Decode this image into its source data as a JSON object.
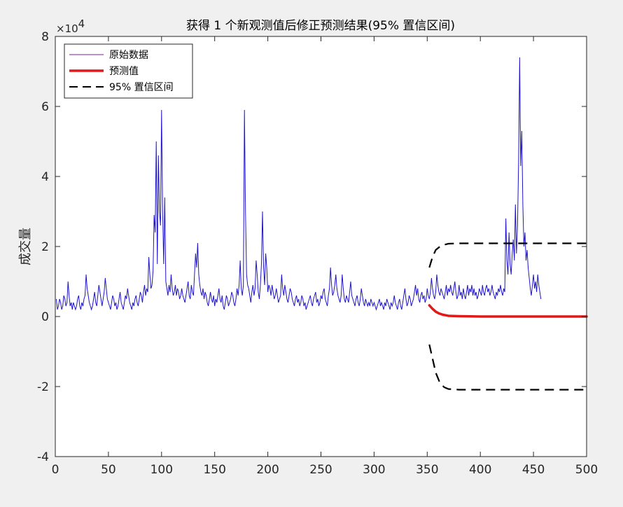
{
  "chart_data": {
    "type": "line",
    "title": "获得 1 个新观测值后修正预测结果(95% 置信区间)",
    "xlabel": "",
    "ylabel": "成交量",
    "y_exponent_label": "×10",
    "y_exponent_power": "4",
    "xlim": [
      0,
      500
    ],
    "ylim": [
      -4,
      8
    ],
    "y_scale_factor": 10000,
    "xticks": [
      "0",
      "50",
      "100",
      "150",
      "200",
      "250",
      "300",
      "350",
      "400",
      "450",
      "500"
    ],
    "yticks": [
      "8",
      "6",
      "4",
      "2",
      "0",
      "-2",
      "-4"
    ],
    "grid": false,
    "legend_position": "top-left",
    "legend": [
      "原始数据",
      "预测值",
      "95% 置信区间"
    ],
    "colors": {
      "raw": "#1f14c8",
      "forecast": "#e01919",
      "ci": "#000000",
      "axes_bg": "#ffffff",
      "figure_bg": "#f0f0f0"
    },
    "series": [
      {
        "name": "原始数据",
        "style": "solid-thin",
        "x_start": 1,
        "x_step": 1,
        "values": [
          0.5,
          0.2,
          0.3,
          0.5,
          0.4,
          0.2,
          0.3,
          0.6,
          0.5,
          0.3,
          0.4,
          1.0,
          0.6,
          0.3,
          0.4,
          0.2,
          0.4,
          0.3,
          0.2,
          0.3,
          0.5,
          0.6,
          0.3,
          0.2,
          0.4,
          0.3,
          0.5,
          0.6,
          1.2,
          0.8,
          0.6,
          0.4,
          0.3,
          0.2,
          0.3,
          0.5,
          0.7,
          0.4,
          0.3,
          0.6,
          0.9,
          0.7,
          0.5,
          0.3,
          0.5,
          0.7,
          1.1,
          0.8,
          0.5,
          0.4,
          0.3,
          0.2,
          0.4,
          0.6,
          0.5,
          0.3,
          0.4,
          0.2,
          0.3,
          0.5,
          0.7,
          0.4,
          0.3,
          0.2,
          0.4,
          0.6,
          0.5,
          0.8,
          0.6,
          0.4,
          0.3,
          0.2,
          0.4,
          0.3,
          0.5,
          0.6,
          0.4,
          0.3,
          0.5,
          0.7,
          0.6,
          0.4,
          0.7,
          0.9,
          0.6,
          0.8,
          0.7,
          1.7,
          1.2,
          0.8,
          0.9,
          1.3,
          2.9,
          2.4,
          5.0,
          1.5,
          4.6,
          3.0,
          2.6,
          5.9,
          3.0,
          1.5,
          3.4,
          1.0,
          0.8,
          0.6,
          0.9,
          0.7,
          1.2,
          0.8,
          0.6,
          0.7,
          0.9,
          0.6,
          0.8,
          0.7,
          0.5,
          0.6,
          0.8,
          0.6,
          0.5,
          0.4,
          0.6,
          0.8,
          1.0,
          0.6,
          0.5,
          0.9,
          0.7,
          0.6,
          1.2,
          1.8,
          1.4,
          2.1,
          1.2,
          0.9,
          0.7,
          0.6,
          0.8,
          0.5,
          0.7,
          0.6,
          0.4,
          0.3,
          0.5,
          0.7,
          0.5,
          0.4,
          0.6,
          0.3,
          0.5,
          0.4,
          0.6,
          0.8,
          0.5,
          0.4,
          0.6,
          0.3,
          0.2,
          0.4,
          0.6,
          0.5,
          0.3,
          0.4,
          0.5,
          0.7,
          0.6,
          0.4,
          0.3,
          0.5,
          0.8,
          0.6,
          0.9,
          1.6,
          0.8,
          0.6,
          0.9,
          5.9,
          3.0,
          1.2,
          0.9,
          0.8,
          0.6,
          0.4,
          0.7,
          0.9,
          0.6,
          0.8,
          1.6,
          1.2,
          0.7,
          0.5,
          0.9,
          1.5,
          3.0,
          1.4,
          0.9,
          1.8,
          1.4,
          0.7,
          0.9,
          0.8,
          0.6,
          0.9,
          0.7,
          0.5,
          0.6,
          0.8,
          0.6,
          0.4,
          0.5,
          0.6,
          1.2,
          0.8,
          0.6,
          0.9,
          0.7,
          0.5,
          0.4,
          0.6,
          0.8,
          0.7,
          0.5,
          0.4,
          0.3,
          0.5,
          0.6,
          0.4,
          0.5,
          0.3,
          0.4,
          0.6,
          0.5,
          0.3,
          0.4,
          0.2,
          0.3,
          0.4,
          0.5,
          0.6,
          0.4,
          0.3,
          0.5,
          0.6,
          0.7,
          0.4,
          0.5,
          0.3,
          0.4,
          0.6,
          0.5,
          0.7,
          0.8,
          0.5,
          0.4,
          0.3,
          0.6,
          0.8,
          1.4,
          0.9,
          0.6,
          0.7,
          0.9,
          1.2,
          0.8,
          0.6,
          0.5,
          0.4,
          0.6,
          1.2,
          0.8,
          0.5,
          0.4,
          0.6,
          0.5,
          0.4,
          0.7,
          1.0,
          0.6,
          0.5,
          0.4,
          0.3,
          0.5,
          0.6,
          0.4,
          0.3,
          0.5,
          0.8,
          0.6,
          0.4,
          0.3,
          0.5,
          0.4,
          0.3,
          0.4,
          0.3,
          0.5,
          0.4,
          0.3,
          0.4,
          0.3,
          0.2,
          0.3,
          0.4,
          0.5,
          0.3,
          0.4,
          0.3,
          0.2,
          0.4,
          0.3,
          0.5,
          0.4,
          0.3,
          0.2,
          0.4,
          0.3,
          0.4,
          0.6,
          0.4,
          0.3,
          0.2,
          0.4,
          0.5,
          0.3,
          0.2,
          0.4,
          0.6,
          0.8,
          0.5,
          0.3,
          0.4,
          0.6,
          0.5,
          0.3,
          0.4,
          0.5,
          0.7,
          0.9,
          0.6,
          0.8,
          0.5,
          0.4,
          0.6,
          0.7,
          0.5,
          0.6,
          0.4,
          0.5,
          0.8,
          0.6,
          0.5,
          0.7,
          1.1,
          0.8,
          0.6,
          0.5,
          0.7,
          1.2,
          0.9,
          0.7,
          0.6,
          0.8,
          0.7,
          0.6,
          0.5,
          0.7,
          0.9,
          0.6,
          0.8,
          0.7,
          0.9,
          0.7,
          0.6,
          0.8,
          1.0,
          0.7,
          0.5,
          0.6,
          0.9,
          0.6,
          0.7,
          0.5,
          0.8,
          0.6,
          0.5,
          0.7,
          0.9,
          0.6,
          0.8,
          0.7,
          0.9,
          0.6,
          0.8,
          0.6,
          0.7,
          0.5,
          0.6,
          0.8,
          0.7,
          0.6,
          0.9,
          0.7,
          0.6,
          0.8,
          0.9,
          0.7,
          0.8,
          0.6,
          0.7,
          0.9,
          0.7,
          0.6,
          0.5,
          0.7,
          0.6,
          0.8,
          0.7,
          0.9,
          0.7,
          0.6,
          0.8,
          0.7,
          2.8,
          1.6,
          1.2,
          2.4,
          1.5,
          1.2,
          1.8,
          2.2,
          1.6,
          3.2,
          1.8,
          2.6,
          4.4,
          7.4,
          4.3,
          5.3,
          3.2,
          2.0,
          2.4,
          1.6,
          1.9,
          1.4,
          1.1,
          0.8,
          0.6,
          0.9,
          1.2,
          0.8,
          1.0,
          0.7,
          1.2,
          0.9,
          0.7,
          0.5
        ]
      },
      {
        "name": "预测值",
        "style": "solid-thick",
        "x": [
          352,
          355,
          358,
          361,
          365,
          370,
          380,
          400,
          450,
          500
        ],
        "values": [
          0.32,
          0.22,
          0.14,
          0.09,
          0.05,
          0.02,
          0.01,
          0.0,
          0.0,
          0.0
        ]
      },
      {
        "name": "95% 置信区间",
        "style": "dashed",
        "x": [
          352,
          352,
          355,
          358,
          362,
          366,
          370,
          380,
          400,
          450,
          500
        ],
        "values": [
          1.4,
          1.4,
          1.7,
          1.9,
          2.0,
          2.05,
          2.08,
          2.09,
          2.09,
          2.09,
          2.09
        ]
      },
      {
        "name": "",
        "style": "dashed",
        "x": [
          352,
          352,
          355,
          358,
          362,
          366,
          370,
          380,
          400,
          450,
          500
        ],
        "values": [
          -0.8,
          -0.8,
          -1.2,
          -1.6,
          -1.9,
          -2.02,
          -2.07,
          -2.09,
          -2.09,
          -2.09,
          -2.09
        ]
      }
    ]
  }
}
